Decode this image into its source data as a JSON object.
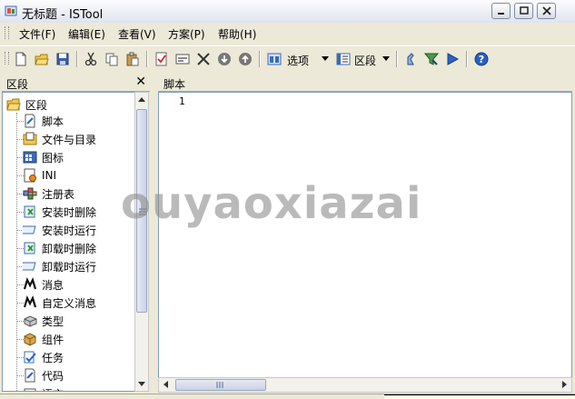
{
  "window": {
    "title": "无标题 - ISTool",
    "icon": "istool-app-icon"
  },
  "menu": {
    "items": [
      "文件(F)",
      "编辑(E)",
      "查看(V)",
      "方案(P)",
      "帮助(H)"
    ]
  },
  "toolbar": {
    "options_label": "选项",
    "section_label": "区段"
  },
  "left_panel": {
    "title": "区段",
    "close_glyph": "✕",
    "root_label": "区段",
    "items": [
      {
        "label": "脚本",
        "icon": "script-icon"
      },
      {
        "label": "文件与目录",
        "icon": "files-dirs-icon"
      },
      {
        "label": "图标",
        "icon": "icons-icon"
      },
      {
        "label": "INI",
        "icon": "ini-icon"
      },
      {
        "label": "注册表",
        "icon": "registry-icon"
      },
      {
        "label": "安装时删除",
        "icon": "install-delete-icon"
      },
      {
        "label": "安装时运行",
        "icon": "install-run-icon"
      },
      {
        "label": "卸载时删除",
        "icon": "uninstall-delete-icon"
      },
      {
        "label": "卸载时运行",
        "icon": "uninstall-run-icon"
      },
      {
        "label": "消息",
        "icon": "messages-icon"
      },
      {
        "label": "自定义消息",
        "icon": "custom-messages-icon"
      },
      {
        "label": "类型",
        "icon": "types-icon"
      },
      {
        "label": "组件",
        "icon": "components-icon"
      },
      {
        "label": "任务",
        "icon": "tasks-icon"
      },
      {
        "label": "代码",
        "icon": "code-icon"
      },
      {
        "label": "语言",
        "icon": "languages-icon"
      }
    ]
  },
  "right_panel": {
    "title": "脚本",
    "line_number": "1"
  },
  "watermark": "ouyaoxiazai"
}
